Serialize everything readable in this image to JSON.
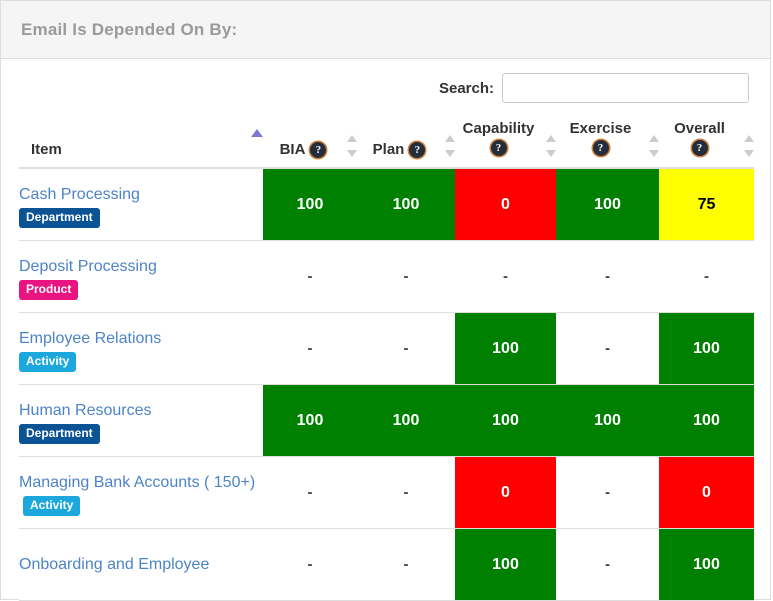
{
  "panel": {
    "title": "Email Is Depended On By:"
  },
  "search": {
    "label": "Search:",
    "value": "",
    "placeholder": ""
  },
  "table": {
    "columns": [
      {
        "label": "Item",
        "wrapped": false,
        "help": false,
        "sort": "asc",
        "align": "left"
      },
      {
        "label": "BIA",
        "wrapped": false,
        "help": true,
        "sort": "none",
        "align": "center"
      },
      {
        "label": "Plan",
        "wrapped": false,
        "help": true,
        "sort": "none",
        "align": "center"
      },
      {
        "label": "Capability",
        "wrapped": true,
        "help": true,
        "sort": "none",
        "align": "center"
      },
      {
        "label": "Exercise",
        "wrapped": true,
        "help": true,
        "sort": "none",
        "align": "center"
      },
      {
        "label": "Overall",
        "wrapped": true,
        "help": true,
        "sort": "none",
        "align": "center"
      }
    ],
    "help_glyph": "?",
    "empty_value": "-",
    "rows": [
      {
        "item": "Cash Processing",
        "badge": {
          "label": "Department",
          "type": "department"
        },
        "badge_inline": false,
        "scores": [
          {
            "value": "100",
            "color": "green"
          },
          {
            "value": "100",
            "color": "green"
          },
          {
            "value": "0",
            "color": "red"
          },
          {
            "value": "100",
            "color": "green"
          },
          {
            "value": "75",
            "color": "yellow"
          }
        ]
      },
      {
        "item": "Deposit Processing",
        "badge": {
          "label": "Product",
          "type": "product"
        },
        "badge_inline": false,
        "scores": [
          {
            "value": "-",
            "color": "none"
          },
          {
            "value": "-",
            "color": "none"
          },
          {
            "value": "-",
            "color": "none"
          },
          {
            "value": "-",
            "color": "none"
          },
          {
            "value": "-",
            "color": "none"
          }
        ]
      },
      {
        "item": "Employee Relations",
        "badge": {
          "label": "Activity",
          "type": "activity"
        },
        "badge_inline": false,
        "scores": [
          {
            "value": "-",
            "color": "none"
          },
          {
            "value": "-",
            "color": "none"
          },
          {
            "value": "100",
            "color": "green"
          },
          {
            "value": "-",
            "color": "none"
          },
          {
            "value": "100",
            "color": "green"
          }
        ]
      },
      {
        "item": "Human Resources",
        "badge": {
          "label": "Department",
          "type": "department"
        },
        "badge_inline": false,
        "scores": [
          {
            "value": "100",
            "color": "green"
          },
          {
            "value": "100",
            "color": "green"
          },
          {
            "value": "100",
            "color": "green"
          },
          {
            "value": "100",
            "color": "green"
          },
          {
            "value": "100",
            "color": "green"
          }
        ]
      },
      {
        "item": "Managing Bank Accounts ( 150+)",
        "badge": {
          "label": "Activity",
          "type": "activity"
        },
        "badge_inline": true,
        "scores": [
          {
            "value": "-",
            "color": "none"
          },
          {
            "value": "-",
            "color": "none"
          },
          {
            "value": "0",
            "color": "red"
          },
          {
            "value": "-",
            "color": "none"
          },
          {
            "value": "0",
            "color": "red"
          }
        ]
      },
      {
        "item": "Onboarding and Employee",
        "badge": null,
        "badge_inline": false,
        "scores": [
          {
            "value": "-",
            "color": "none"
          },
          {
            "value": "-",
            "color": "none"
          },
          {
            "value": "100",
            "color": "green"
          },
          {
            "value": "-",
            "color": "none"
          },
          {
            "value": "100",
            "color": "green"
          }
        ]
      }
    ]
  }
}
